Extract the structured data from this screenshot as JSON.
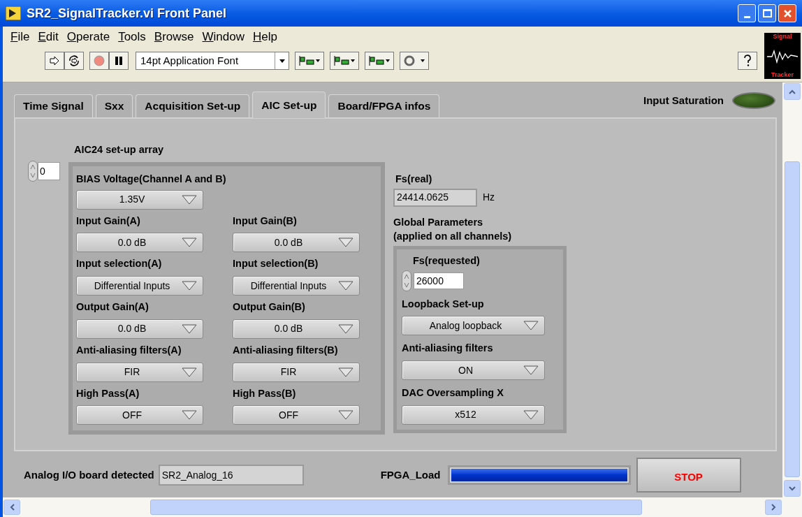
{
  "window": {
    "title": "SR2_SignalTracker.vi Front Panel"
  },
  "menu": [
    "File",
    "Edit",
    "Operate",
    "Tools",
    "Browse",
    "Window",
    "Help"
  ],
  "toolbar": {
    "font": "14pt Application Font"
  },
  "logo": [
    "Signal",
    "Tracker"
  ],
  "tabs": [
    {
      "label": "Time Signal",
      "selected": false
    },
    {
      "label": "Sxx",
      "selected": false
    },
    {
      "label": "Acquisition Set-up",
      "selected": false
    },
    {
      "label": "AIC Set-up",
      "selected": true
    },
    {
      "label": "Board/FPGA infos",
      "selected": false
    }
  ],
  "saturation": {
    "label": "Input Saturation",
    "on": false
  },
  "array": {
    "label": "AIC24 set-up array",
    "index": "0",
    "bias": {
      "label": "BIAS Voltage(Channel A and B)",
      "value": "1.35V"
    },
    "rows": [
      {
        "a": {
          "label": "Input Gain(A)",
          "value": "0.0 dB"
        },
        "b": {
          "label": "Input Gain(B)",
          "value": "0.0 dB"
        }
      },
      {
        "a": {
          "label": "Input selection(A)",
          "value": "Differential Inputs"
        },
        "b": {
          "label": "Input selection(B)",
          "value": "Differential Inputs"
        }
      },
      {
        "a": {
          "label": "Output Gain(A)",
          "value": "0.0 dB"
        },
        "b": {
          "label": "Output Gain(B)",
          "value": "0.0 dB"
        }
      },
      {
        "a": {
          "label": "Anti-aliasing filters(A)",
          "value": "FIR"
        },
        "b": {
          "label": "Anti-aliasing filters(B)",
          "value": "FIR"
        }
      },
      {
        "a": {
          "label": "High Pass(A)",
          "value": "OFF"
        },
        "b": {
          "label": "High Pass(B)",
          "value": "OFF"
        }
      }
    ]
  },
  "fs_real": {
    "label": "Fs(real)",
    "value": "24414.0625",
    "unit": "Hz"
  },
  "global": {
    "label": "Global Parameters\n(applied on all channels)",
    "fs_requested": {
      "label": "Fs(requested)",
      "value": "26000"
    },
    "selectors": [
      {
        "label": "Loopback Set-up",
        "value": "Analog loopback"
      },
      {
        "label": "Anti-aliasing filters",
        "value": "ON"
      },
      {
        "label": "DAC Oversampling X",
        "value": "x512"
      }
    ]
  },
  "board": {
    "label": "Analog I/O board detected",
    "value": "SR2_Analog_16"
  },
  "fpga": {
    "label": "FPGA_Load",
    "level": 1
  },
  "stop": "STOP"
}
